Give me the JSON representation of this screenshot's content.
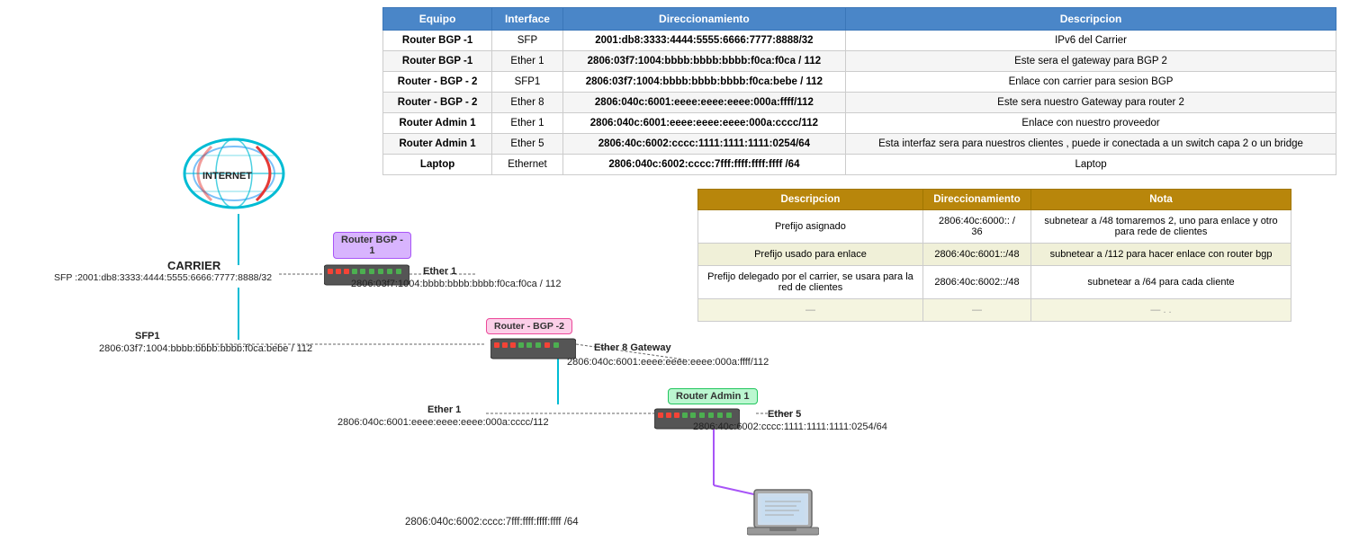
{
  "table": {
    "headers": [
      "Equipo",
      "Interface",
      "Direccionamiento",
      "Descripcion"
    ],
    "rows": [
      {
        "equipo": "Router BGP -1",
        "interface": "SFP",
        "dir": "2001:db8:3333:4444:5555:6666:7777:8888/32",
        "desc": "IPv6 del Carrier"
      },
      {
        "equipo": "Router BGP -1",
        "interface": "Ether 1",
        "dir": "2806:03f7:1004:bbbb:bbbb:bbbb:f0ca:f0ca / 112",
        "desc": "Este sera el gateway para BGP 2"
      },
      {
        "equipo": "Router - BGP - 2",
        "interface": "SFP1",
        "dir": "2806:03f7:1004:bbbb:bbbb:bbbb:f0ca:bebe / 112",
        "desc": "Enlace con carrier para sesion BGP"
      },
      {
        "equipo": "Router - BGP - 2",
        "interface": "Ether 8",
        "dir": "2806:040c:6001:eeee:eeee:eeee:000a:ffff/112",
        "desc": "Este sera nuestro Gateway para router 2"
      },
      {
        "equipo": "Router Admin 1",
        "interface": "Ether 1",
        "dir": "2806:040c:6001:eeee:eeee:eeee:000a:cccc/112",
        "desc": "Enlace con nuestro proveedor"
      },
      {
        "equipo": "Router Admin 1",
        "interface": "Ether 5",
        "dir": "2806:40c:6002:cccc:1111:1111:1111:0254/64",
        "desc": "Esta interfaz sera para nuestros clientes , puede ir conectada a un switch capa 2 o un bridge"
      },
      {
        "equipo": "Laptop",
        "interface": "Ethernet",
        "dir": "2806:040c:6002:cccc:7fff:ffff:ffff:ffff /64",
        "desc": "Laptop"
      }
    ]
  },
  "sec_table": {
    "headers": [
      "Descripcion",
      "Direccionamiento",
      "Nota"
    ],
    "rows": [
      {
        "desc": "Prefijo asignado",
        "dir": "2806:40c:6000:: / 36",
        "nota": "subnetear a /48  tomaremos 2, uno para enlace y otro para rede de clientes"
      },
      {
        "desc": "Prefijo usado para enlace",
        "dir": "2806:40c:6001::/48",
        "nota": "subnetear a /112 para hacer enlace con router bgp"
      },
      {
        "desc": "Prefijo delegado por el carrier, se usara para la red de clientes",
        "dir": "2806:40c:6002::/48",
        "nota": "subnetear a /64 para cada cliente"
      },
      {
        "desc": "—",
        "dir": "—",
        "nota": "— . ."
      }
    ]
  },
  "diagram": {
    "internet_label": "INTERNET",
    "carrier_label": "CARRIER",
    "carrier_addr": "SFP :2001:db8:3333:4444:5555:6666:7777:8888/32",
    "router_bgp1_label": "Router BGP -\n1",
    "router_bgp2_label": "Router - BGP -2",
    "router_admin_label": "Router Admin 1",
    "ether1_label_bgp1": "Ether 1",
    "ether1_addr_bgp1": "2806:03f7:1004:bbbb:bbbb:bbbb:f0ca:f0ca / 112",
    "sfp1_label": "SFP1",
    "sfp1_addr": "2806:03f7:1004:bbbb:bbbb:bbbb:f0ca:bebe / 112",
    "ether8_label": "Ether 8 Gateway",
    "ether8_addr": "2806:040c:6001:eeee:eeee:eeee:000a:ffff/112",
    "ether1_label_admin": "Ether 1",
    "ether1_addr_admin": "2806:040c:6001:eeee:eeee:eeee:000a:cccc/112",
    "ether5_label": "Ether 5",
    "ether5_addr": "2806:40c:6002:cccc:1111:1111:1111:0254/64",
    "laptop_addr": "2806:040c:6002:cccc:7fff:ffff:ffff:ffff /64"
  }
}
